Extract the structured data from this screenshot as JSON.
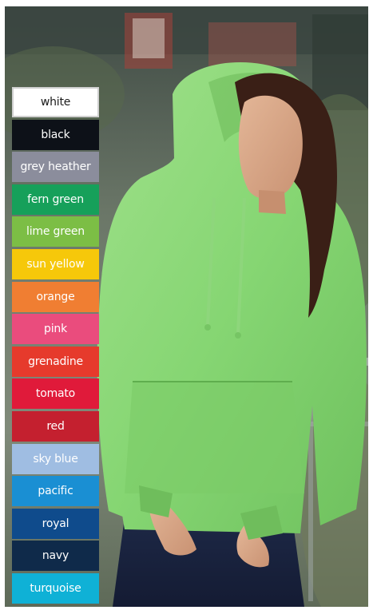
{
  "photo": {
    "description_icon": "woman-in-hoodie-photo"
  },
  "swatches": [
    {
      "label": "white",
      "color": "#ffffff"
    },
    {
      "label": "black",
      "color": "#0d1118"
    },
    {
      "label": "grey heather",
      "color": "#8b8d9c"
    },
    {
      "label": "fern green",
      "color": "#16a05a"
    },
    {
      "label": "lime green",
      "color": "#7cbe45"
    },
    {
      "label": "sun yellow",
      "color": "#f6c80a"
    },
    {
      "label": "orange",
      "color": "#f07e32"
    },
    {
      "label": "pink",
      "color": "#ea4c7d"
    },
    {
      "label": "grenadine",
      "color": "#e63a2c"
    },
    {
      "label": "tomato",
      "color": "#e01a3a"
    },
    {
      "label": "red",
      "color": "#c4202f"
    },
    {
      "label": "sky blue",
      "color": "#9fbde2"
    },
    {
      "label": "pacific",
      "color": "#1a8fd3"
    },
    {
      "label": "royal",
      "color": "#0f4b8c"
    },
    {
      "label": "navy",
      "color": "#0f2a4a"
    },
    {
      "label": "turquoise",
      "color": "#0fb1d6"
    }
  ]
}
